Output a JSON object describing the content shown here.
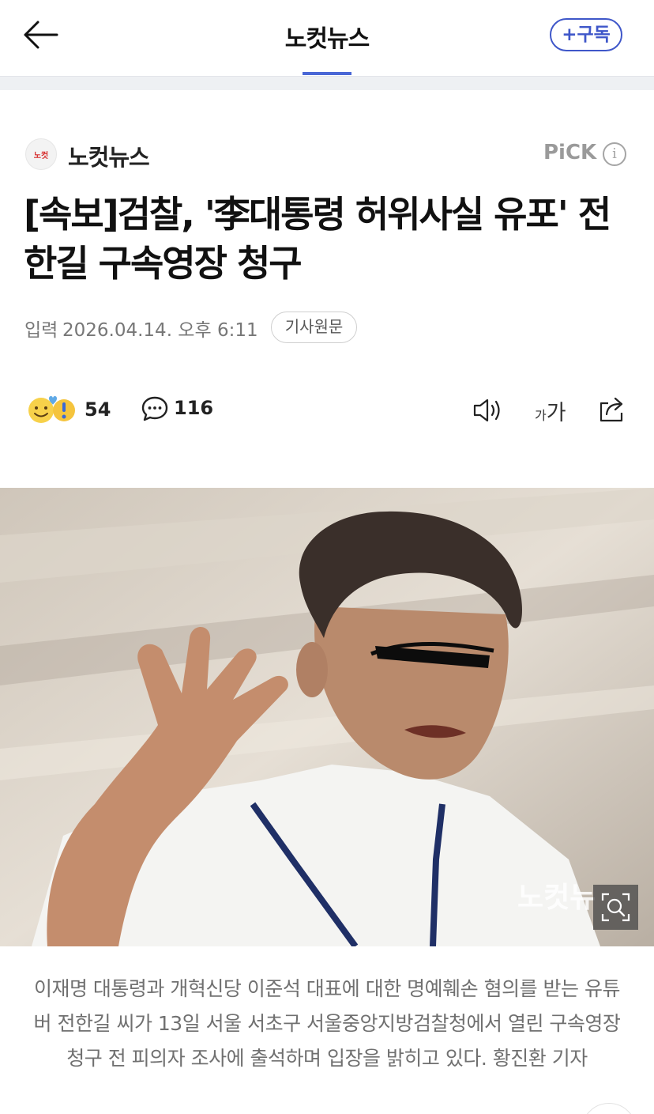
{
  "top_bar": {
    "title": "노컷뉴스",
    "subscribe_label": "+구독"
  },
  "press": {
    "logo_text": "노컷",
    "name": "노컷뉴스",
    "pick_label": "PiCK",
    "info_glyph": "i"
  },
  "article": {
    "headline": "[속보]검찰, '李대통령 허위사실 유포' 전한길 구속영장 청구",
    "date_label": "입력",
    "date_value": "2026.04.14. 오후 6:11",
    "original_label": "기사원문"
  },
  "actions": {
    "reaction_count": "54",
    "comment_count": "116",
    "font_small": "가",
    "font_big": "가"
  },
  "photo": {
    "watermark": "노컷뉴"
  },
  "caption": "이재명 대통령과 개혁신당 이준석 대표에 대한 명예훼손 혐의를 받는 유튜버 전한길 씨가 13일 서울 서초구 서울중앙지방검찰청에서 열린 구속영장 청구 전 피의자 조사에 출석하며 입장을 밝히고 있다. 황진환 기자",
  "icons": [
    "back-arrow-icon",
    "info-icon",
    "reaction-emoji-icon",
    "comment-icon",
    "speaker-icon",
    "font-size-icon",
    "share-icon",
    "zoom-icon"
  ],
  "colors": {
    "accent": "#3f57c9",
    "tab_indicator": "#4a67d6",
    "logo_red": "#d62d2d"
  }
}
